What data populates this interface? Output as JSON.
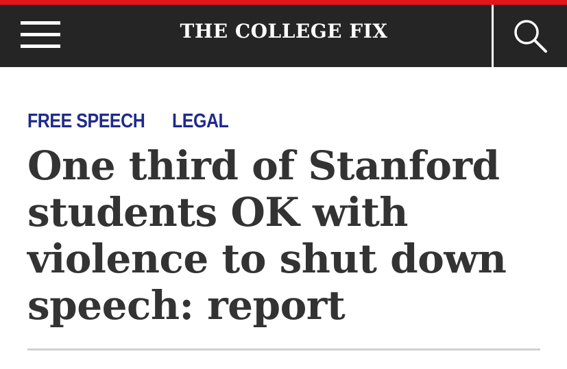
{
  "colors": {
    "accent": "#e4141b",
    "header_bg": "#252525",
    "category_link": "#1f2a8c",
    "headline_text": "#333333",
    "divider": "#d0d0d0"
  },
  "header": {
    "site_title": "THE COLLEGE FIX",
    "menu_icon": "hamburger-menu-icon",
    "search_icon": "search-icon"
  },
  "article": {
    "categories": [
      {
        "label": "FREE SPEECH"
      },
      {
        "label": "LEGAL"
      }
    ],
    "headline": "One third of Stanford students OK with violence to shut down speech: report"
  }
}
